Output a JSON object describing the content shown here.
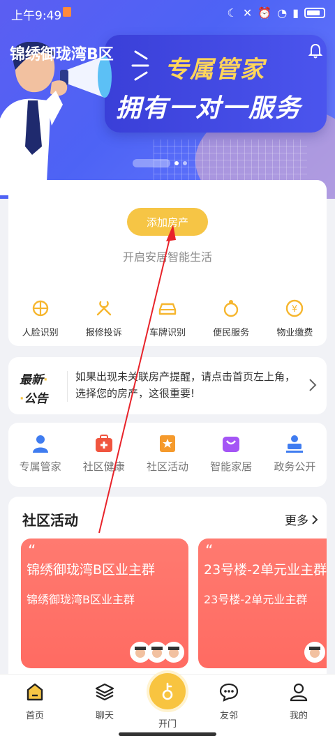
{
  "status_bar": {
    "time": "上午9:49"
  },
  "header": {
    "community_name": "锦绣御珑湾B区"
  },
  "banner": {
    "title_line1": "专属管家",
    "title_line2": "拥有一对一服务"
  },
  "main_card": {
    "add_button": "添加房产",
    "subtitle": "开启安居智能生活"
  },
  "quick_actions": [
    {
      "label": "人脸识别",
      "icon": "face-recognition-icon"
    },
    {
      "label": "报修投诉",
      "icon": "repair-icon"
    },
    {
      "label": "车牌识别",
      "icon": "car-icon"
    },
    {
      "label": "便民服务",
      "icon": "service-icon"
    },
    {
      "label": "物业缴费",
      "icon": "payment-icon"
    }
  ],
  "notice": {
    "logo_line1": "最新",
    "logo_line2": "公告",
    "text": "如果出现未关联房产提醒，请点击首页左上角，选择您的房产，这很重要!"
  },
  "services": [
    {
      "label": "专属管家",
      "icon": "butler-icon",
      "color": "#3f7cf0"
    },
    {
      "label": "社区健康",
      "icon": "health-icon",
      "color": "#f0553f"
    },
    {
      "label": "社区活动",
      "icon": "activity-icon",
      "color": "#f59a2c"
    },
    {
      "label": "智能家居",
      "icon": "smart-home-icon",
      "color": "#a455f5"
    },
    {
      "label": "政务公开",
      "icon": "government-icon",
      "color": "#3f7cf0"
    }
  ],
  "activities": {
    "title": "社区活动",
    "more": "更多",
    "items": [
      {
        "title": "锦绣御珑湾B区业主群",
        "subtitle": "锦绣御珑湾B区业主群"
      },
      {
        "title": "23号楼-2单元业主群",
        "subtitle": "23号楼-2单元业主群"
      }
    ]
  },
  "bottom_nav": {
    "home": "首页",
    "chat": "聊天",
    "open": "开门",
    "neighbors": "友邻",
    "mine": "我的"
  },
  "colors": {
    "accent": "#f6c545",
    "banner": "#4d63f5",
    "activity_tile": "#ff6b62",
    "annotation": "#e8232a"
  }
}
